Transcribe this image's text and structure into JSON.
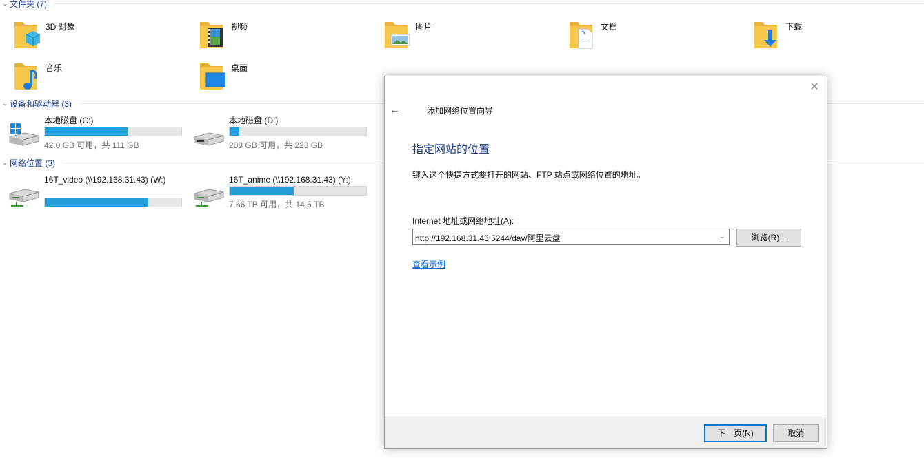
{
  "sections": {
    "folders": "文件夹 (7)",
    "devices": "设备和驱动器 (3)",
    "network": "网络位置 (3)"
  },
  "folders": [
    {
      "name": "3D 对象",
      "icon": "3d-objects-folder-icon"
    },
    {
      "name": "视频",
      "icon": "videos-folder-icon"
    },
    {
      "name": "图片",
      "icon": "pictures-folder-icon"
    },
    {
      "name": "文档",
      "icon": "documents-folder-icon"
    },
    {
      "name": "下载",
      "icon": "downloads-folder-icon"
    },
    {
      "name": "音乐",
      "icon": "music-folder-icon"
    },
    {
      "name": "桌面",
      "icon": "desktop-folder-icon"
    }
  ],
  "drives": [
    {
      "name": "本地磁盘 (C:)",
      "info": "42.0 GB 可用，共 111 GB",
      "used_fraction": 0.61,
      "icon": "windows-drive-icon"
    },
    {
      "name": "本地磁盘 (D:)",
      "info": "208 GB 可用，共 223 GB",
      "used_fraction": 0.07,
      "icon": "hard-drive-icon"
    }
  ],
  "network_drives": [
    {
      "name": "16T_video (\\\\192.168.31.43) (W:)",
      "info": "",
      "used_fraction": 0.76,
      "icon": "network-drive-icon"
    },
    {
      "name": "16T_anime (\\\\192.168.31.43) (Y:)",
      "info": "7.66 TB 可用，共 14.5 TB",
      "used_fraction": 0.47,
      "icon": "network-drive-icon"
    }
  ],
  "dialog": {
    "title": "添加网络位置向导",
    "heading": "指定网站的位置",
    "instruction": "键入这个快捷方式要打开的网站、FTP 站点或网络位置的地址。",
    "field_label": "Internet 地址或网络地址(A):",
    "field_value": "http://192.168.31.43:5244/dav/阿里云盘",
    "browse_label": "浏览(R)...",
    "example_link": "查看示例",
    "next_label": "下一页(N)",
    "cancel_label": "取消"
  },
  "colors": {
    "accent": "#26a0da",
    "header_text": "#1e3f8f",
    "link": "#0066cc",
    "folder_yellow": "#f6c94c"
  }
}
